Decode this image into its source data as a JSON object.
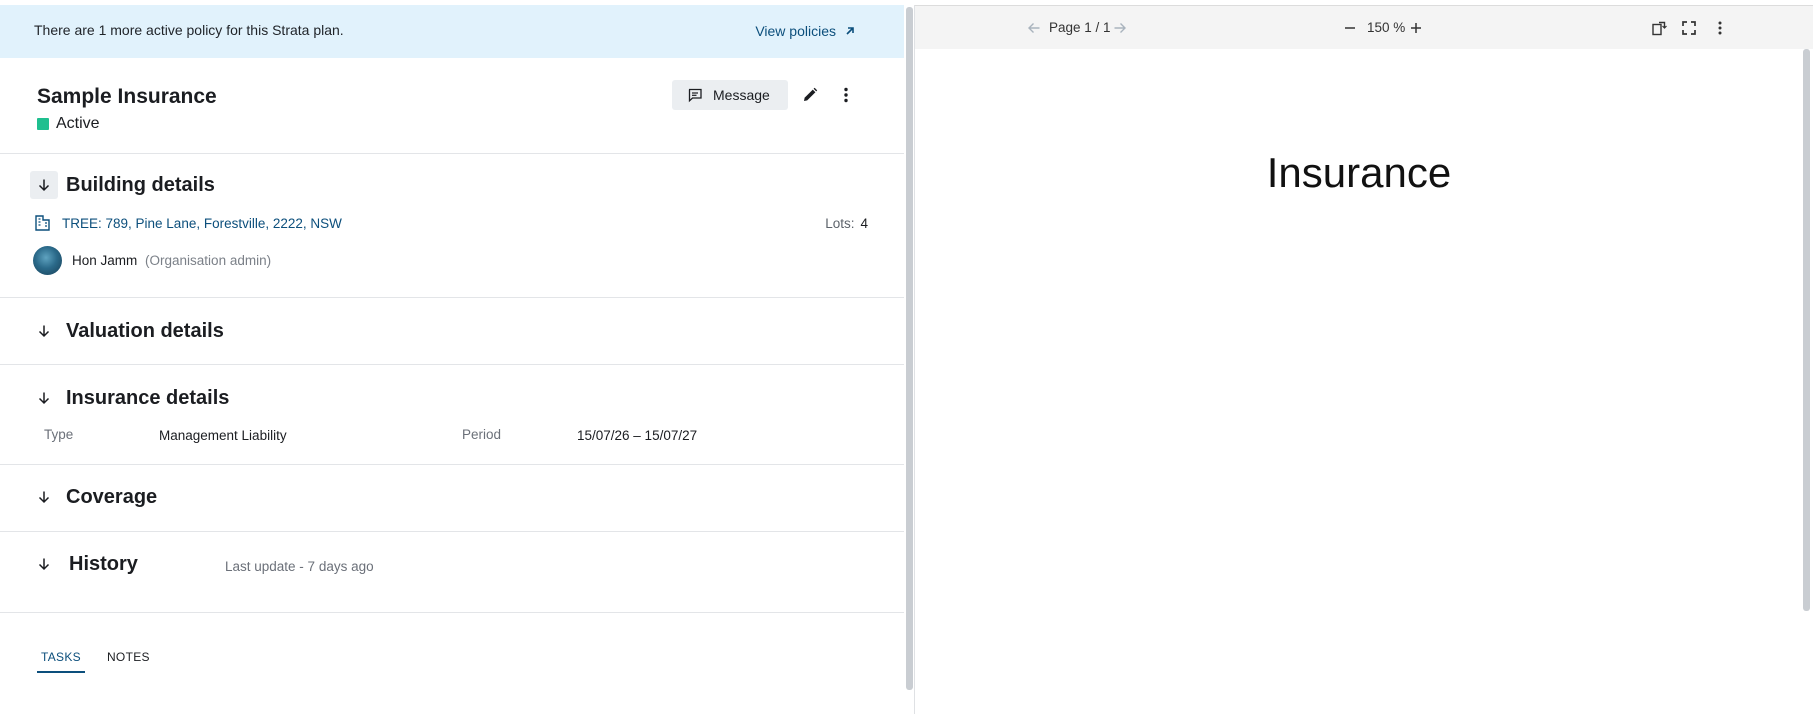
{
  "banner": {
    "text": "There are 1 more active policy for this Strata plan.",
    "link_label": "View policies"
  },
  "policy": {
    "title": "Sample Insurance",
    "status": "Active",
    "status_color": "#1fbf8f",
    "message_label": "Message"
  },
  "sections": {
    "building": {
      "title": "Building details",
      "address": "TREE: 789, Pine Lane, Forestville, 2222, NSW",
      "lots_label": "Lots:",
      "lots_value": "4",
      "admin_name": "Hon Jamm",
      "admin_role": "(Organisation admin)"
    },
    "valuation": {
      "title": "Valuation details"
    },
    "insurance": {
      "title": "Insurance details",
      "type_label": "Type",
      "type_value": "Management Liability",
      "period_label": "Period",
      "period_value": "15/07/26 – 15/07/27"
    },
    "coverage": {
      "title": "Coverage"
    },
    "history": {
      "title": "History",
      "last_update": "Last update - 7 days ago"
    }
  },
  "tabs": [
    {
      "label": "TASKS",
      "active": true
    },
    {
      "label": "NOTES",
      "active": false
    }
  ],
  "pdf_viewer": {
    "page_label": "Page 1 / 1",
    "zoom_label": "150 %",
    "document_heading": "Insurance"
  },
  "colors": {
    "accent": "#0c4f7c",
    "banner_bg": "#e1f2fc"
  }
}
